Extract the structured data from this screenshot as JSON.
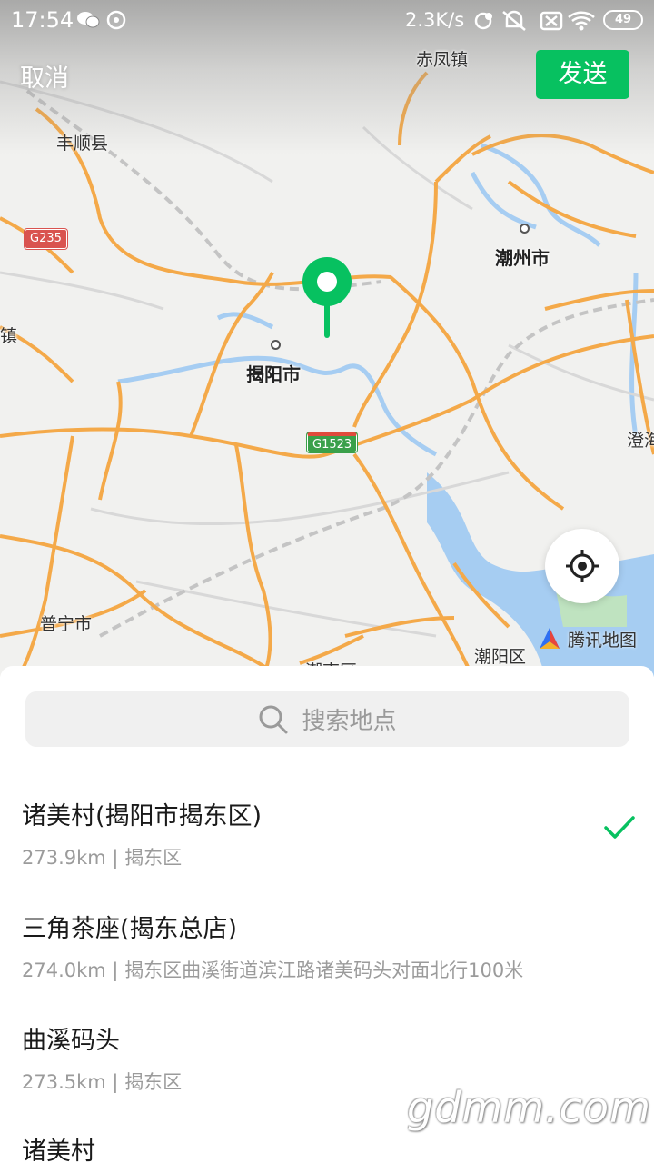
{
  "status_bar": {
    "time": "17:54",
    "network_speed": "2.3K/s",
    "battery": "49",
    "icons": [
      "wechat-icon",
      "music-icon",
      "sync-icon",
      "mute-icon",
      "sim-off-icon",
      "wifi-icon",
      "battery-icon"
    ]
  },
  "header": {
    "cancel_label": "取消",
    "send_label": "发送",
    "send_color": "#07c160"
  },
  "map": {
    "labels": {
      "chifeng": "赤凤镇",
      "fengshun": "丰顺县",
      "chaozhou": "潮州市",
      "jieyang": "揭阳市",
      "puning": "普宁市",
      "chaoyang": "潮阳区",
      "chenghai": "澄海",
      "zhen": "镇",
      "bottom_partial": "潮南区"
    },
    "shields": {
      "g235": "G235",
      "g1523": "G1523"
    },
    "brand": "腾讯地图",
    "pin_color": "#07c160"
  },
  "search": {
    "placeholder": "搜索地点"
  },
  "places": [
    {
      "title": "诸美村(揭阳市揭东区)",
      "subtitle": "273.9km | 揭东区",
      "selected": true
    },
    {
      "title": "三角茶座(揭东总店)",
      "subtitle": "274.0km | 揭东区曲溪街道滨江路诸美码头对面北行100米"
    },
    {
      "title": "曲溪码头",
      "subtitle": "273.5km | 揭东区"
    },
    {
      "title": "诸美村",
      "subtitle": ""
    }
  ],
  "watermark": "gdmm.com"
}
